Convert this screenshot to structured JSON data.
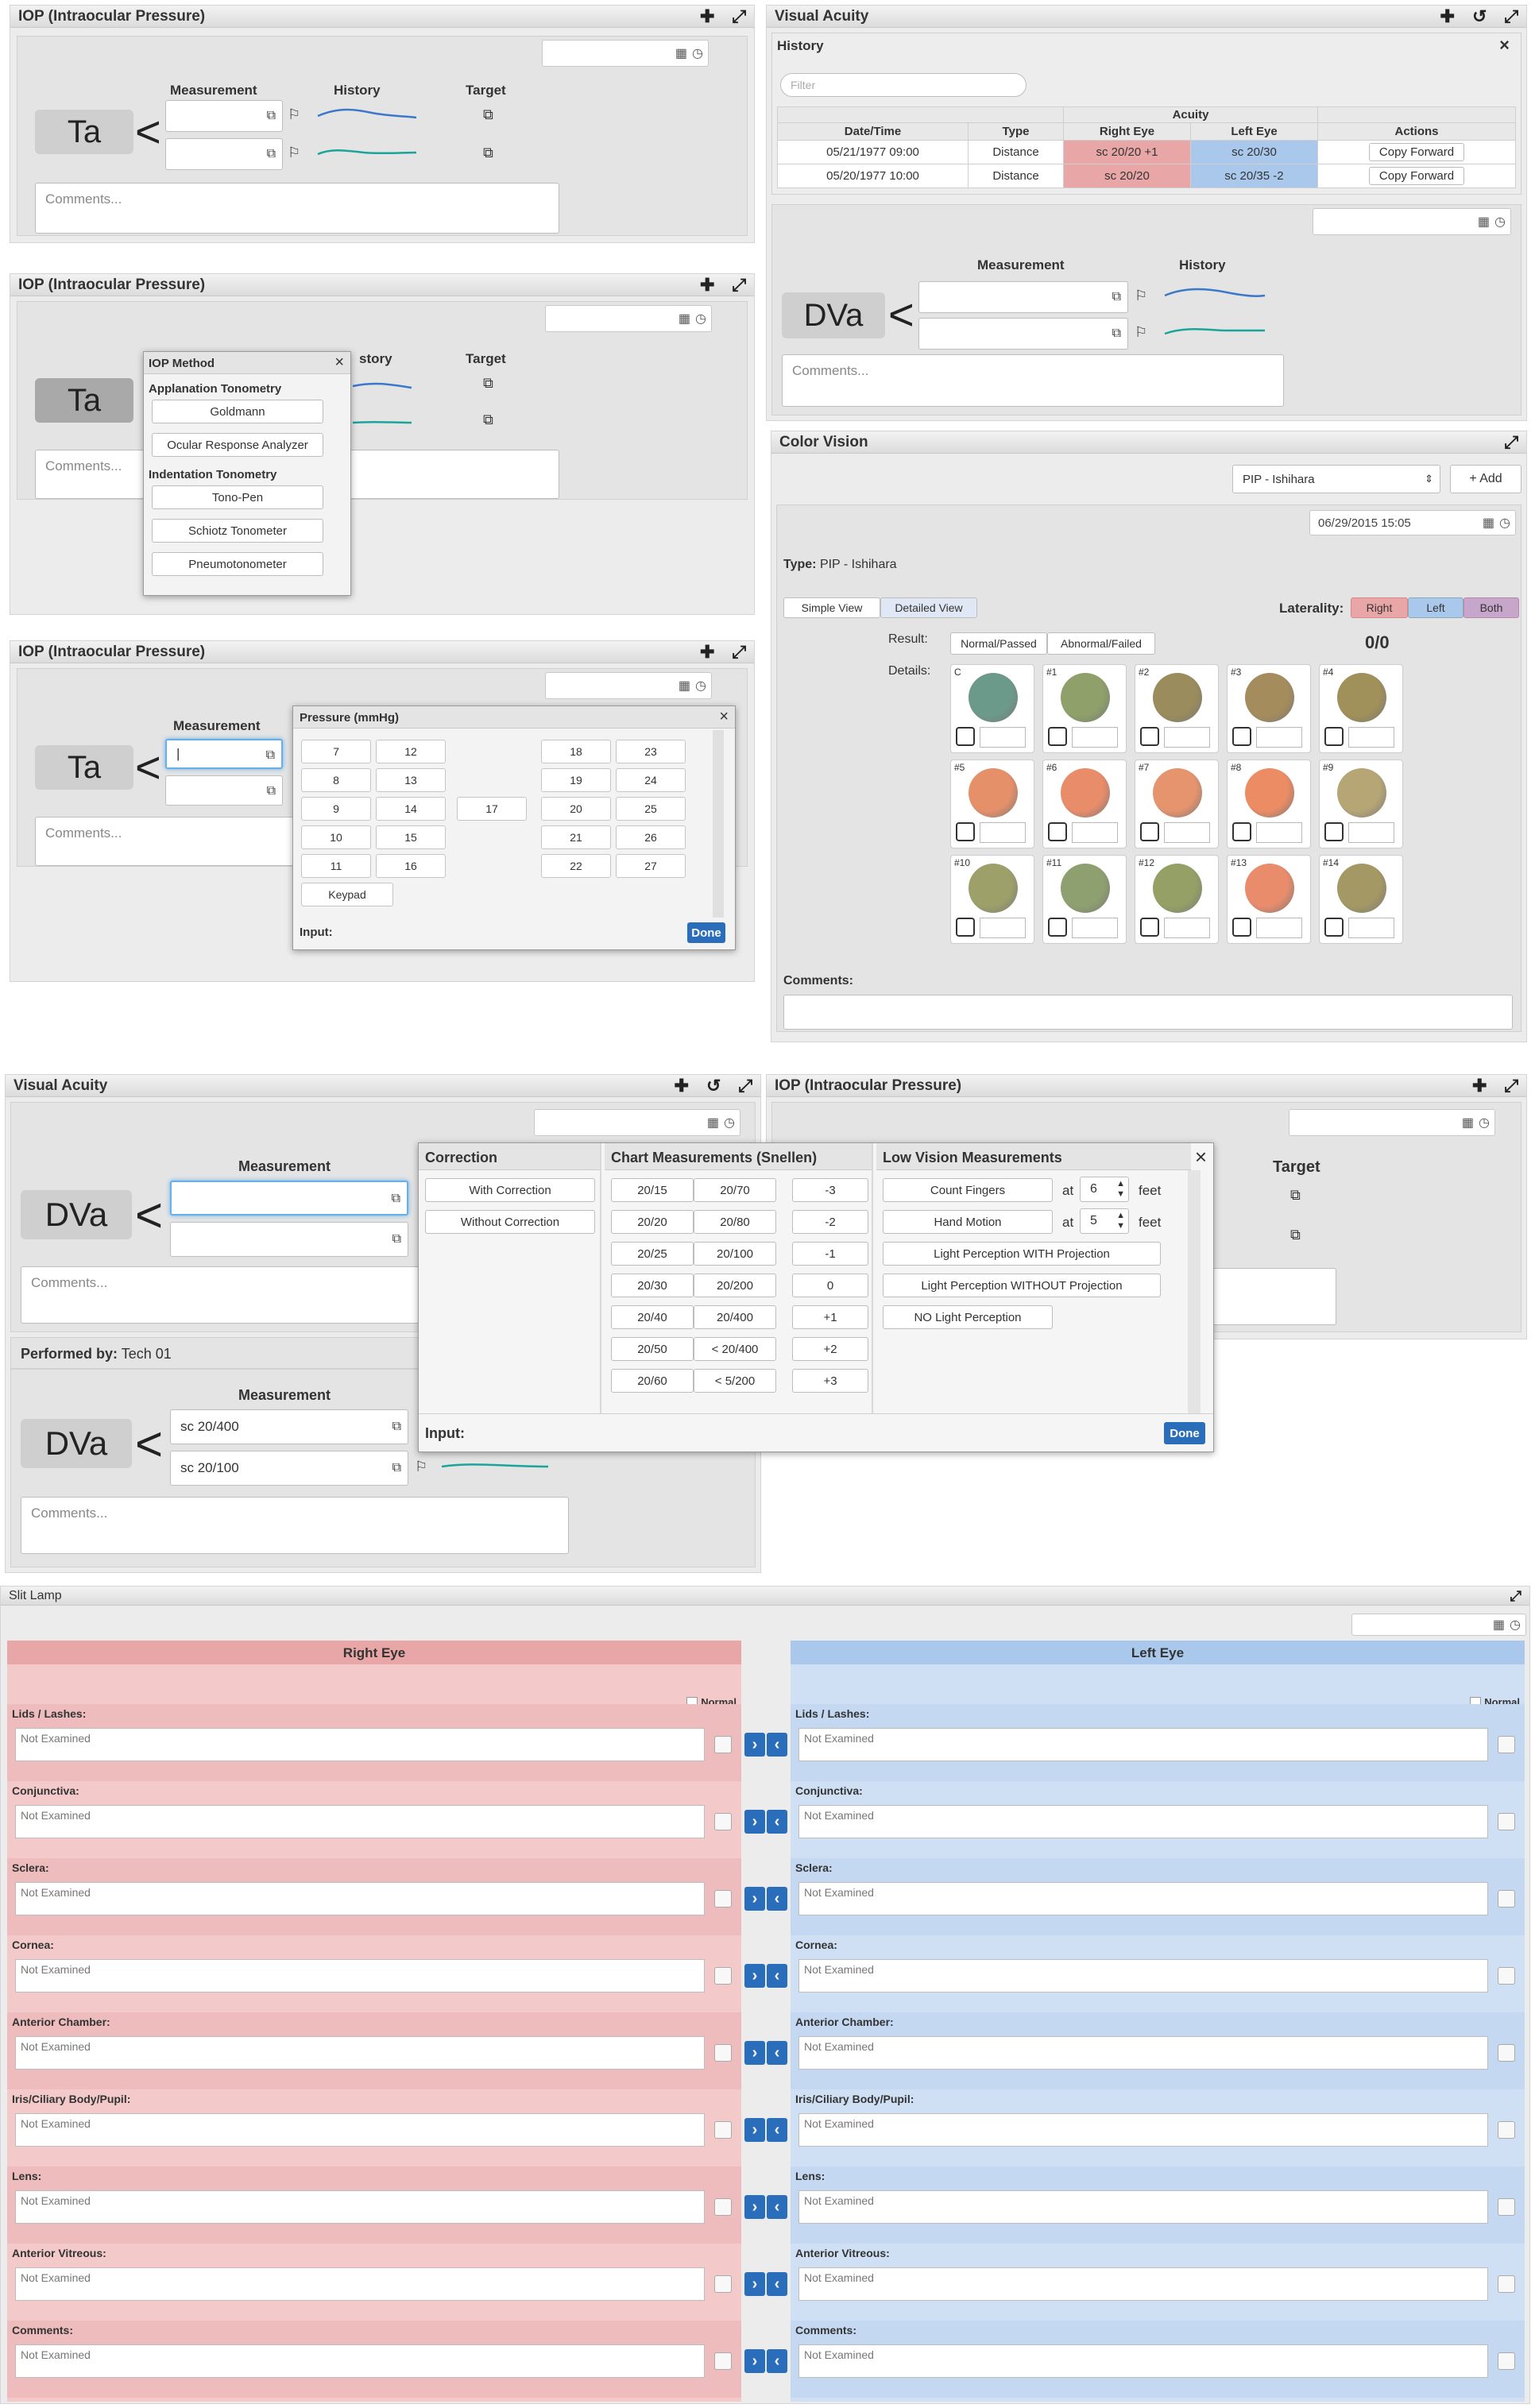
{
  "colors": {
    "right_eye": "#e8a6a6",
    "left_eye": "#a9c8ec",
    "accent": "#2a6ebb"
  },
  "iop": {
    "title": "IOP (Intraocular Pressure)",
    "big": "Ta",
    "col_measurement": "Measurement",
    "col_history": "History",
    "col_target": "Target",
    "comments_placeholder": "Comments..."
  },
  "iop_method": {
    "title": "IOP Method",
    "history_partial": "story",
    "group1": "Applanation Tonometry",
    "group1_items": [
      "Goldmann",
      "Ocular Response Analyzer"
    ],
    "group2": "Indentation Tonometry",
    "group2_items": [
      "Tono-Pen",
      "Schiotz Tonometer",
      "Pneumotonometer"
    ]
  },
  "pressure": {
    "title": "Pressure (mmHg)",
    "col1": [
      "7",
      "8",
      "9",
      "10",
      "11"
    ],
    "col2": [
      "12",
      "13",
      "14",
      "15",
      "16"
    ],
    "col3": [
      "17"
    ],
    "col4": [
      "18",
      "19",
      "20",
      "21",
      "22"
    ],
    "col5": [
      "23",
      "24",
      "25",
      "26",
      "27"
    ],
    "keypad": "Keypad",
    "input_label": "Input:",
    "done": "Done"
  },
  "va": {
    "title": "Visual Acuity",
    "history_label": "History",
    "filter_placeholder": "Filter",
    "acuity": "Acuity",
    "headers": [
      "Date/Time",
      "Type",
      "Right Eye",
      "Left Eye",
      "Actions"
    ],
    "rows": [
      {
        "date": "05/21/1977 09:00",
        "type": "Distance",
        "right": "sc 20/20 +1",
        "left": "sc 20/30",
        "action": "Copy Forward"
      },
      {
        "date": "05/20/1977 10:00",
        "type": "Distance",
        "right": "sc 20/20",
        "left": "sc 20/35 -2",
        "action": "Copy Forward"
      }
    ],
    "big": "DVa",
    "col_measurement": "Measurement",
    "col_history": "History",
    "comments_placeholder": "Comments..."
  },
  "cv": {
    "title": "Color Vision",
    "select": "PIP - Ishihara",
    "add": "+ Add",
    "date": "06/29/2015 15:05",
    "type_label": "Type:",
    "type_value": "PIP - Ishihara",
    "simple_view": "Simple View",
    "detailed_view": "Detailed View",
    "laterality": "Laterality:",
    "lat_right": "Right",
    "lat_left": "Left",
    "lat_both": "Both",
    "result_label": "Result:",
    "normal": "Normal/Passed",
    "abnormal": "Abnormal/Failed",
    "score": "0/0",
    "details_label": "Details:",
    "plates": [
      "C",
      "#1",
      "#2",
      "#3",
      "#4",
      "#5",
      "#6",
      "#7",
      "#8",
      "#9",
      "#10",
      "#11",
      "#12",
      "#13",
      "#14"
    ],
    "plate_colors": [
      "#6c9a8a",
      "#8fa06a",
      "#9a8c5c",
      "#a58c5c",
      "#a0905a",
      "#e6906a",
      "#e98c6a",
      "#e6946e",
      "#ec8c64",
      "#b6a676",
      "#9ea06a",
      "#8fa070",
      "#94a066",
      "#e88c6c",
      "#a49864"
    ],
    "comments_label": "Comments:"
  },
  "va2": {
    "title": "Visual Acuity",
    "big": "DVa",
    "col_measurement": "Measurement",
    "comments_placeholder": "Comments...",
    "performed_by_label": "Performed by:",
    "performed_by": "Tech 01",
    "m1": "sc 20/400",
    "m2": "sc 20/100"
  },
  "iop2": {
    "title": "IOP (Intraocular Pressure)",
    "col_target": "Target"
  },
  "snellen": {
    "correction_title": "Correction",
    "with_correction": "With Correction",
    "without_correction": "Without Correction",
    "chart_title": "Chart Measurements (Snellen)",
    "col1": [
      "20/15",
      "20/20",
      "20/25",
      "20/30",
      "20/40",
      "20/50",
      "20/60"
    ],
    "col2": [
      "20/70",
      "20/80",
      "20/100",
      "20/200",
      "20/400",
      "< 20/400",
      "< 5/200"
    ],
    "col3": [
      "-3",
      "-2",
      "-1",
      "0",
      "+1",
      "+2",
      "+3"
    ],
    "low_title": "Low Vision Measurements",
    "count_fingers": "Count Fingers",
    "hand_motion": "Hand Motion",
    "at": "at",
    "feet": "feet",
    "cf_value": "6",
    "hm_value": "5",
    "lp_with": "Light Perception WITH Projection",
    "lp_without": "Light Perception WITHOUT Projection",
    "nlp": "NO Light Perception",
    "input_label": "Input:",
    "done": "Done"
  },
  "slit": {
    "title": "Slit Lamp",
    "right_eye": "Right Eye",
    "left_eye": "Left Eye",
    "normal": "Normal",
    "placeholder": "Not Examined",
    "rows": [
      "Lids / Lashes:",
      "Conjunctiva:",
      "Sclera:",
      "Cornea:",
      "Anterior Chamber:",
      "Iris/Ciliary Body/Pupil:",
      "Lens:",
      "Anterior Vitreous:",
      "Comments:"
    ]
  }
}
